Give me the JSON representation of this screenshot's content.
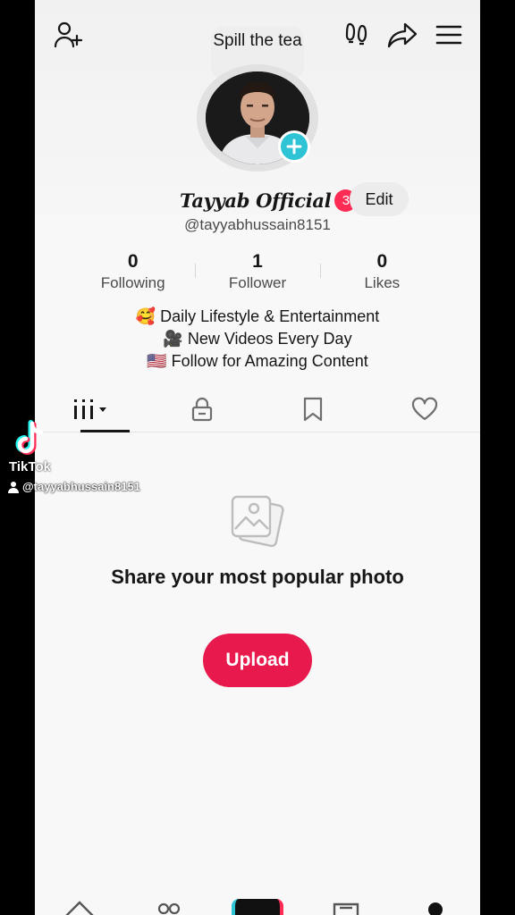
{
  "header": {
    "bubble_text": "Spill the tea",
    "icons": [
      "add-user-icon",
      "footprints-icon",
      "share-icon",
      "menu-icon"
    ]
  },
  "profile": {
    "display_name": "Tayyab Official",
    "notification_count": "3",
    "edit_label": "Edit",
    "username": "@tayyabhussain8151"
  },
  "stats": [
    {
      "value": "0",
      "label": "Following"
    },
    {
      "value": "1",
      "label": "Follower"
    },
    {
      "value": "0",
      "label": "Likes"
    }
  ],
  "bio": [
    "🥰 Daily Lifestyle & Entertainment",
    "🎥 New Videos Every Day",
    "🇺🇸 Follow for Amazing Content"
  ],
  "tabs": [
    "videos-grid-icon",
    "lock-icon",
    "bookmark-icon",
    "heart-icon"
  ],
  "empty_state": {
    "title": "Share your most popular photo",
    "button_label": "Upload"
  },
  "watermark": {
    "brand": "TikTok",
    "user": "@tayyabhussain8151"
  },
  "colors": {
    "accent": "#fe2c55",
    "upload": "#e8194d",
    "avatar_plus": "#2ec4d6"
  }
}
